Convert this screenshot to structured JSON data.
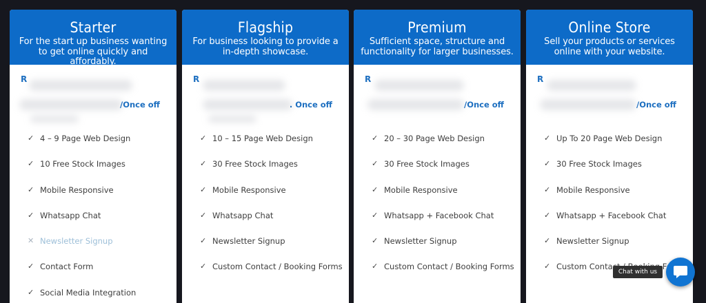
{
  "plans": [
    {
      "title": "Starter",
      "subtitle": "For the start up business wanting to get online quickly and affordably.",
      "currency": "R",
      "period": "/Once off",
      "features": [
        {
          "text": "4 – 9 Page Web Design",
          "included": true,
          "icon": "check-icon"
        },
        {
          "text": "10 Free Stock Images",
          "included": true,
          "icon": "check-icon"
        },
        {
          "text": "Mobile Responsive",
          "included": true,
          "icon": "check-icon"
        },
        {
          "text": "Whatsapp Chat",
          "included": true,
          "icon": "check-icon"
        },
        {
          "text": "Newsletter Signup",
          "included": false,
          "icon": "cross-icon"
        },
        {
          "text": "Contact Form",
          "included": true,
          "icon": "check-icon"
        },
        {
          "text": "Social Media Integration",
          "included": true,
          "icon": "check-icon"
        }
      ]
    },
    {
      "title": "Flagship",
      "subtitle": "For business looking to provide a in-depth showcase.",
      "currency": "R",
      "period": ". Once off",
      "features": [
        {
          "text": "10 – 15 Page Web Design",
          "included": true,
          "icon": "check-icon"
        },
        {
          "text": "30 Free Stock Images",
          "included": true,
          "icon": "check-icon"
        },
        {
          "text": "Mobile Responsive",
          "included": true,
          "icon": "check-icon"
        },
        {
          "text": "Whatsapp Chat",
          "included": true,
          "icon": "check-icon"
        },
        {
          "text": "Newsletter Signup",
          "included": true,
          "icon": "check-icon"
        },
        {
          "text": "Custom Contact / Booking Forms",
          "included": true,
          "icon": "check-icon"
        }
      ]
    },
    {
      "title": "Premium",
      "subtitle": "Sufficient space, structure and functionality for larger businesses.",
      "currency": "R",
      "period": "/Once off",
      "features": [
        {
          "text": "20 – 30 Page Web Design",
          "included": true,
          "icon": "check-icon"
        },
        {
          "text": "30 Free Stock Images",
          "included": true,
          "icon": "check-icon"
        },
        {
          "text": "Mobile Responsive",
          "included": true,
          "icon": "check-icon"
        },
        {
          "text": "Whatsapp + Facebook Chat",
          "included": true,
          "icon": "check-icon"
        },
        {
          "text": "Newsletter Signup",
          "included": true,
          "icon": "check-icon"
        },
        {
          "text": "Custom Contact / Booking Forms",
          "included": true,
          "icon": "check-icon"
        }
      ]
    },
    {
      "title": "Online Store",
      "subtitle": "Sell your products or services online with your website.",
      "currency": "R",
      "period": "/Once off",
      "features": [
        {
          "text": "Up To 20 Page Web Design",
          "included": true,
          "icon": "check-icon"
        },
        {
          "text": "30 Free Stock Images",
          "included": true,
          "icon": "check-icon"
        },
        {
          "text": "Mobile Responsive",
          "included": true,
          "icon": "check-icon"
        },
        {
          "text": "Whatsapp + Facebook Chat",
          "included": true,
          "icon": "check-icon"
        },
        {
          "text": "Newsletter Signup",
          "included": true,
          "icon": "check-icon"
        },
        {
          "text": "Custom Contact / Booking Forms",
          "included": true,
          "icon": "check-icon"
        }
      ]
    }
  ],
  "chat": {
    "tooltip": "Chat with us",
    "icon": "chat-bubble-icon"
  },
  "colors": {
    "page_background": "#16171e",
    "header_blue": "#0d6bc8",
    "price_blue": "#1d6fc0",
    "excluded_text": "#9dbfd8",
    "chat_button": "#1074d2"
  }
}
